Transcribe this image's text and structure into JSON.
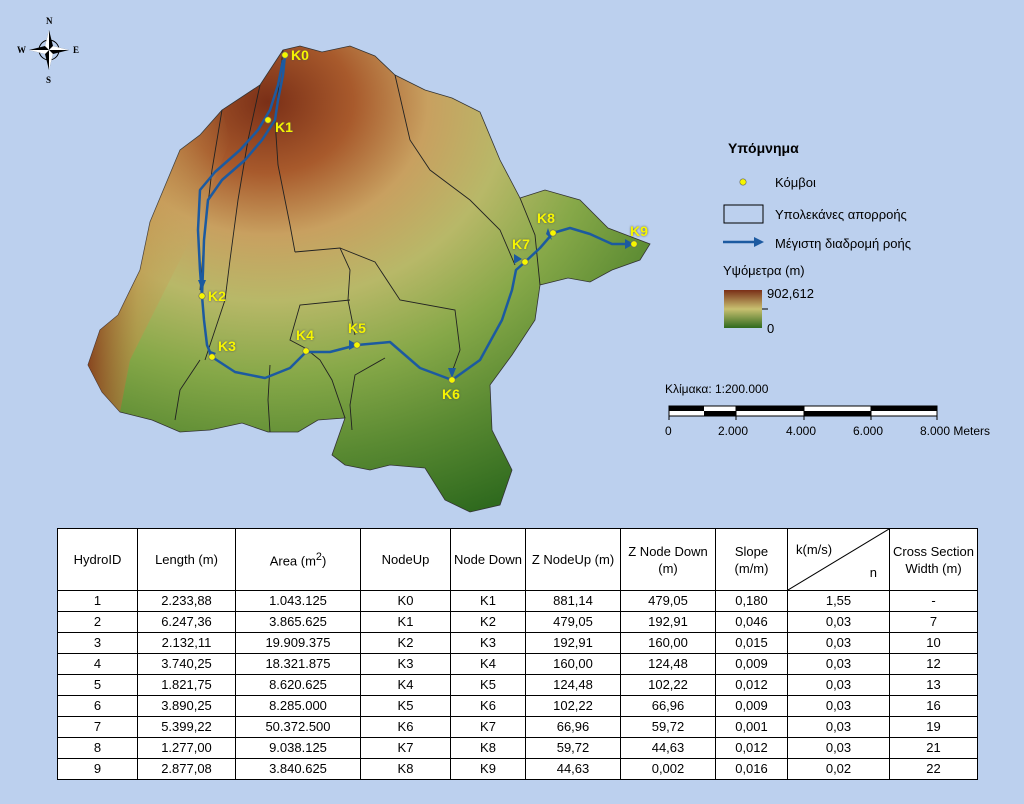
{
  "compass": {
    "n": "N",
    "s": "S",
    "e": "E",
    "w": "W"
  },
  "nodes": [
    {
      "label": "K0"
    },
    {
      "label": "K1"
    },
    {
      "label": "K2"
    },
    {
      "label": "K3"
    },
    {
      "label": "K4"
    },
    {
      "label": "K5"
    },
    {
      "label": "K6"
    },
    {
      "label": "K7"
    },
    {
      "label": "K8"
    },
    {
      "label": "K9"
    }
  ],
  "legend": {
    "title": "Υπόμνημα",
    "nodes": "Κόμβοι",
    "subbasins": "Υπολεκάνες απορροής",
    "flowpath": "Μέγιστη διαδρομή ροής",
    "elevation_title": "Υψόμετρα (m)",
    "elevation_max": "902,612",
    "elevation_min": "0"
  },
  "scale": {
    "ratio": "Κλίμακα: 1:200.000",
    "ticks": [
      "0",
      "2.000",
      "4.000",
      "6.000",
      "8.000 Meters"
    ]
  },
  "colors": {
    "background": "#bcd0ee",
    "river": "#1c5aa0",
    "node": "#f6f600",
    "elevation_high": "#7a2f17",
    "elevation_mid": "#c8c070",
    "elevation_low": "#2f6a1e"
  },
  "table": {
    "headers": {
      "hydroid": "HydroID",
      "length": "Length (m)",
      "area": "Area (m",
      "area_sup": "2",
      "area_close": ")",
      "nodeup": "NodeUp",
      "nodedown": "Node Down",
      "znodeup": "Z NodeUp (m)",
      "znodedown": "Z Node Down (m)",
      "slope": "Slope (m/m)",
      "k": "k(m/s)",
      "n": "n",
      "width": "Cross Section Width (m)"
    },
    "rows": [
      [
        "1",
        "2.233,88",
        "1.043.125",
        "K0",
        "K1",
        "881,14",
        "479,05",
        "0,180",
        "1,55",
        "-"
      ],
      [
        "2",
        "6.247,36",
        "3.865.625",
        "K1",
        "K2",
        "479,05",
        "192,91",
        "0,046",
        "0,03",
        "7"
      ],
      [
        "3",
        "2.132,11",
        "19.909.375",
        "K2",
        "K3",
        "192,91",
        "160,00",
        "0,015",
        "0,03",
        "10"
      ],
      [
        "4",
        "3.740,25",
        "18.321.875",
        "K3",
        "K4",
        "160,00",
        "124,48",
        "0,009",
        "0,03",
        "12"
      ],
      [
        "5",
        "1.821,75",
        "8.620.625",
        "K4",
        "K5",
        "124,48",
        "102,22",
        "0,012",
        "0,03",
        "13"
      ],
      [
        "6",
        "3.890,25",
        "8.285.000",
        "K5",
        "K6",
        "102,22",
        "66,96",
        "0,009",
        "0,03",
        "16"
      ],
      [
        "7",
        "5.399,22",
        "50.372.500",
        "K6",
        "K7",
        "66,96",
        "59,72",
        "0,001",
        "0,03",
        "19"
      ],
      [
        "8",
        "1.277,00",
        "9.038.125",
        "K7",
        "K8",
        "59,72",
        "44,63",
        "0,012",
        "0,03",
        "21"
      ],
      [
        "9",
        "2.877,08",
        "3.840.625",
        "K8",
        "K9",
        "44,63",
        "0,002",
        "0,016",
        "0,02",
        "22"
      ]
    ]
  }
}
